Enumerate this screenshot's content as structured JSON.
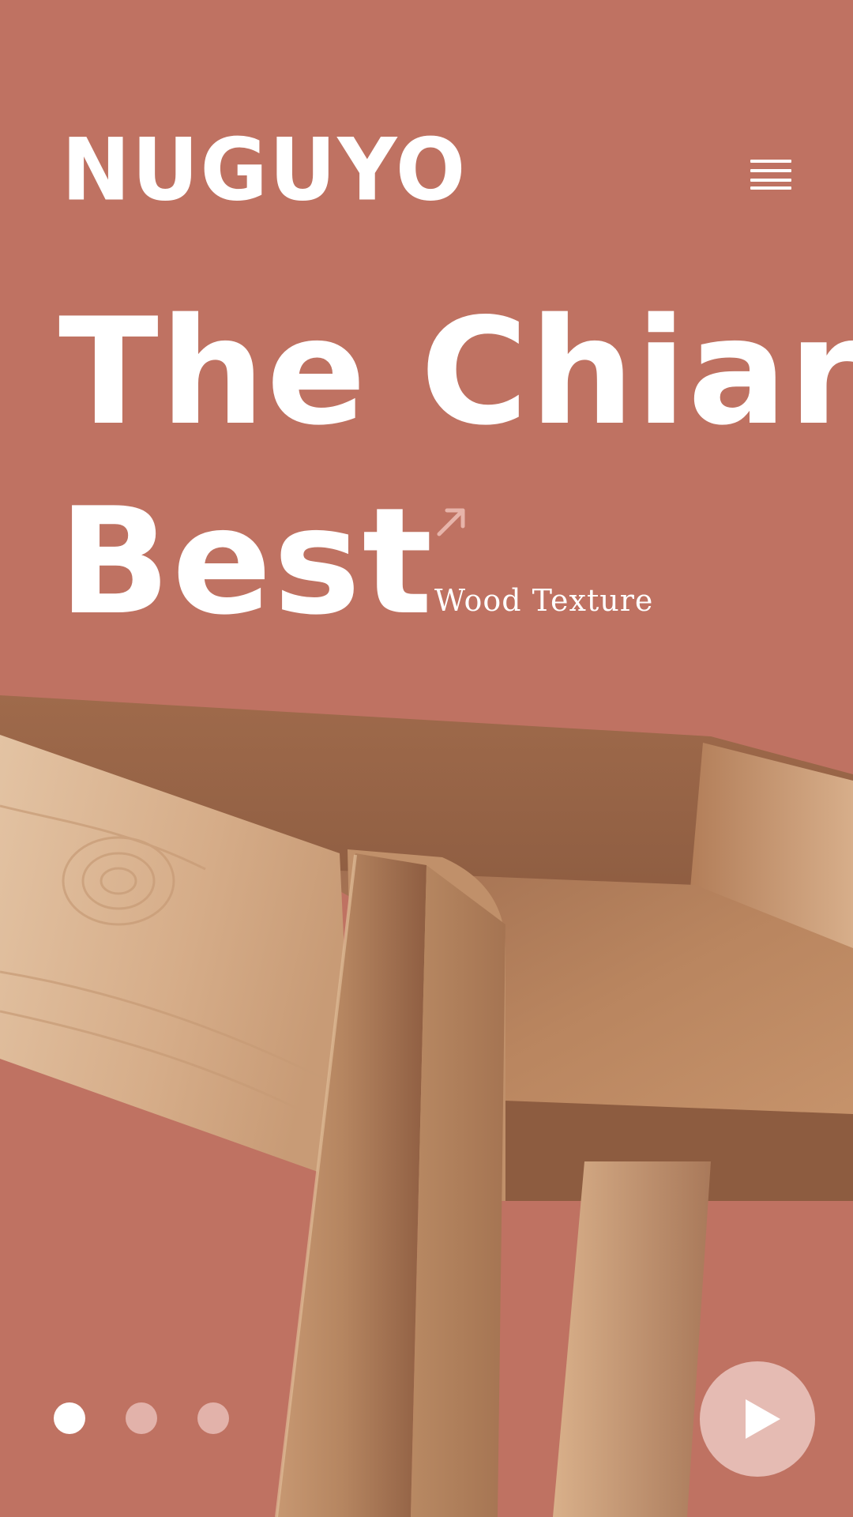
{
  "brand": {
    "logo_text": "NUGUYO"
  },
  "header": {
    "menu_icon": "hamburger-menu-icon"
  },
  "hero": {
    "headline_line1": "The Chiar",
    "headline_line2": "Best",
    "subtitle": "Wood Texture",
    "arrow_icon": "arrow-up-right-icon",
    "image": "wooden-chair-photo"
  },
  "carousel": {
    "slide_count": 3,
    "active_index": 0,
    "dots": [
      {
        "active": true
      },
      {
        "active": false
      },
      {
        "active": false
      }
    ]
  },
  "play_button": {
    "icon": "play-icon"
  },
  "colors": {
    "background": "#bf7262",
    "text": "#ffffff",
    "dot_active": "#ffffff",
    "dot_inactive": "#e2b2aa",
    "arrow": "#e7b4aa",
    "play_button_bg": "#f0d0ca",
    "wood_light": "#d9b08a",
    "wood_mid": "#b98560",
    "wood_dark": "#8a5a3f"
  }
}
